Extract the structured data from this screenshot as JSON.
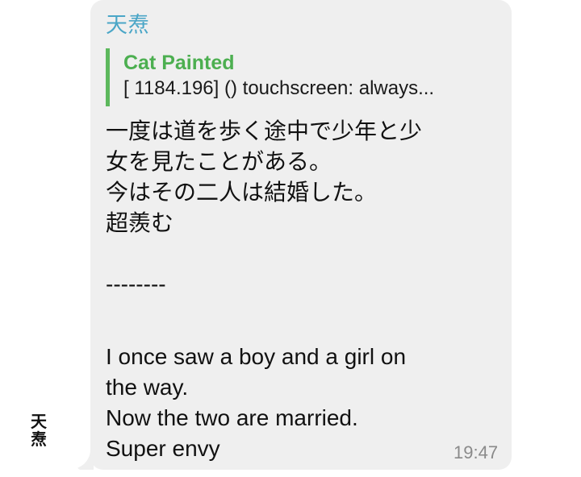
{
  "avatar": {
    "glyph_top": "天",
    "glyph_bottom": "焘"
  },
  "message": {
    "sender_name": "天焘",
    "reply": {
      "author": "Cat Painted",
      "preview": "[  1184.196] () touchscreen: always..."
    },
    "lines": [
      "一度は道を歩く途中で少年と少",
      "女を見たことがある。",
      "今はその二人は結婚した。",
      "超羨む",
      "",
      "--------",
      "",
      "I once saw a boy and a girl on",
      "the way.",
      "Now the two are married.",
      "Super envy"
    ],
    "time": "19:47"
  },
  "colors": {
    "bubble_bg": "#efefef",
    "sender_name": "#4aa6c7",
    "reply_bar": "#5cb85c",
    "reply_author": "#4caf50",
    "timestamp": "#8a8a8a"
  }
}
